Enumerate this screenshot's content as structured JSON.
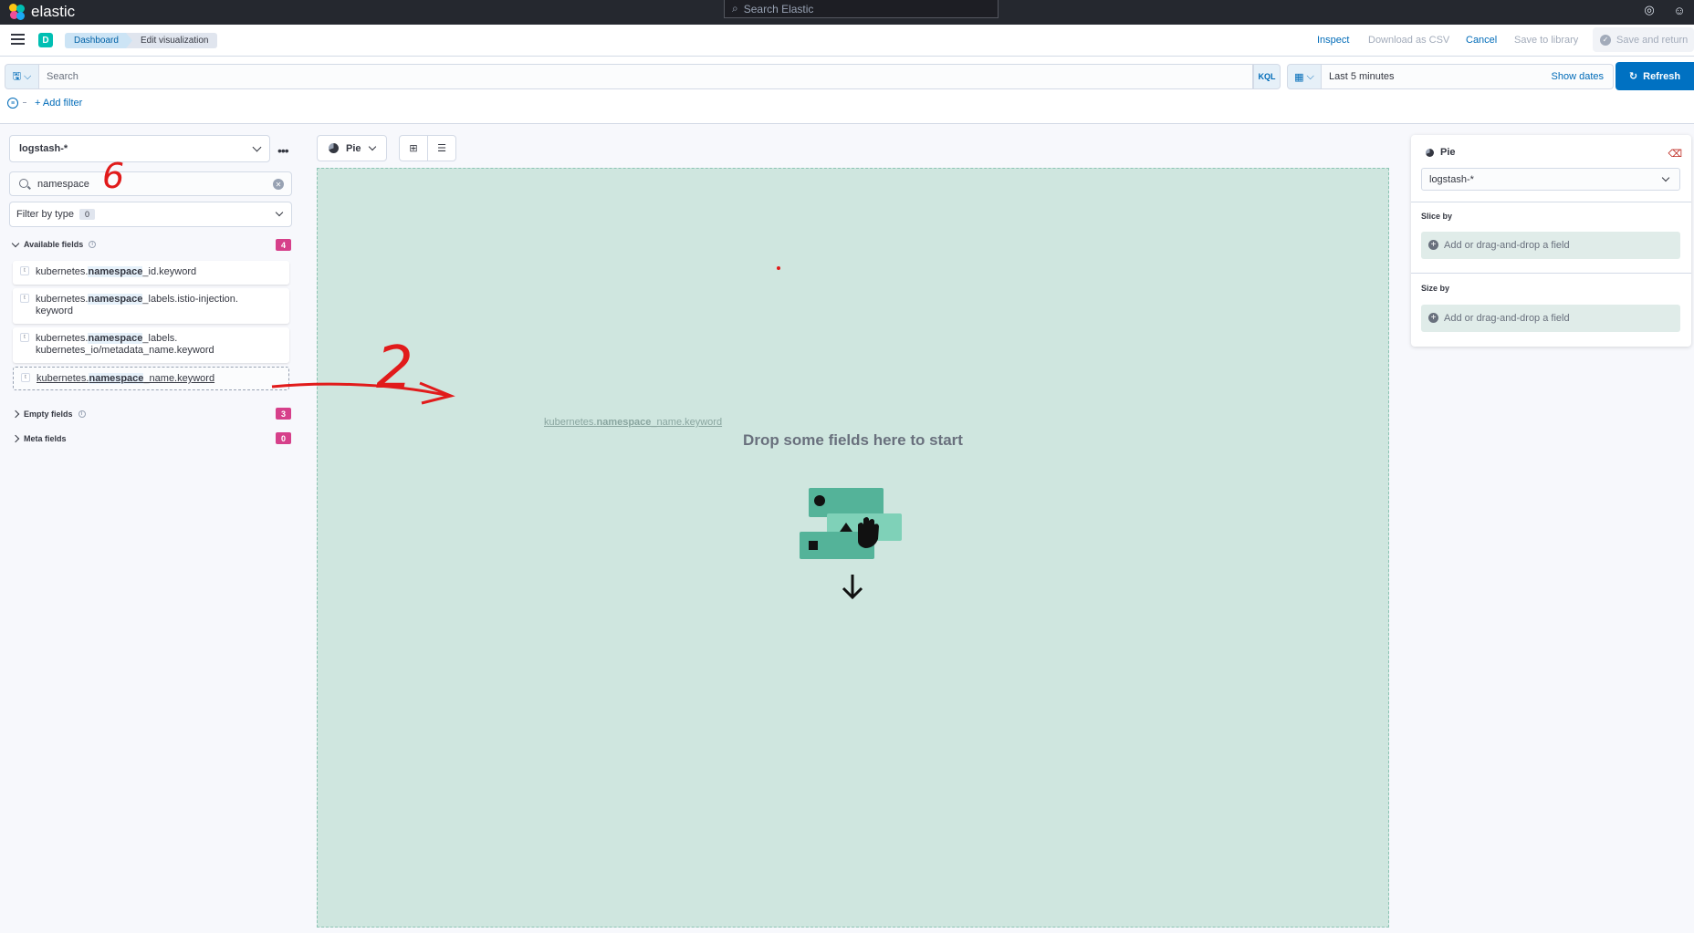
{
  "app": {
    "name": "elastic"
  },
  "global_search": {
    "placeholder": "Search Elastic"
  },
  "header": {
    "space_initial": "D",
    "breadcrumbs": [
      "Dashboard",
      "Edit visualization"
    ],
    "actions": {
      "inspect": "Inspect",
      "download_csv": "Download as CSV",
      "cancel": "Cancel",
      "save_library": "Save to library",
      "save_return": "Save and return"
    }
  },
  "query_bar": {
    "search_placeholder": "Search",
    "language": "KQL",
    "time_range": "Last 5 minutes",
    "show_dates": "Show dates",
    "refresh": "Refresh",
    "add_filter": "+ Add filter"
  },
  "sidebar": {
    "index_pattern": "logstash-*",
    "field_search_value": "namespace",
    "filter_by_type": "Filter by type",
    "filter_count": "0",
    "available_label": "Available fields",
    "available_count": "4",
    "fields": [
      {
        "type": "t",
        "prefix": "kubernetes.",
        "match": "namespace",
        "suffix": "_id.keyword"
      },
      {
        "type": "t",
        "prefix": "kubernetes.",
        "match": "namespace",
        "suffix": "_labels.istio-injection.",
        "line2": "keyword"
      },
      {
        "type": "t",
        "prefix": "kubernetes.",
        "match": "namespace",
        "suffix": "_labels.",
        "line2": "kubernetes_io/metadata_name.keyword"
      },
      {
        "type": "t",
        "prefix": "kubernetes.",
        "match": "namespace",
        "suffix": "_name.keyword"
      }
    ],
    "empty_label": "Empty fields",
    "empty_count": "3",
    "meta_label": "Meta fields",
    "meta_count": "0"
  },
  "toolbar": {
    "chart_type": "Pie"
  },
  "workspace": {
    "drag_ghost_prefix": "kubernetes.",
    "drag_ghost_match": "namespace",
    "drag_ghost_suffix": "_name.keyword",
    "drop_title": "Drop some fields here to start"
  },
  "config": {
    "title": "Pie",
    "index_pattern": "logstash-*",
    "slice_label": "Slice by",
    "slice_placeholder": "Add or drag-and-drop a field",
    "size_label": "Size by",
    "size_placeholder": "Add or drag-and-drop a field"
  },
  "annotations": {
    "label_6": "6",
    "label_2": "2"
  },
  "colors": {
    "accent": "#0071c2",
    "link": "#006bb8",
    "workspace": "#cfe6df",
    "badge": "#d6408a",
    "annotation": "#e11b1b"
  }
}
